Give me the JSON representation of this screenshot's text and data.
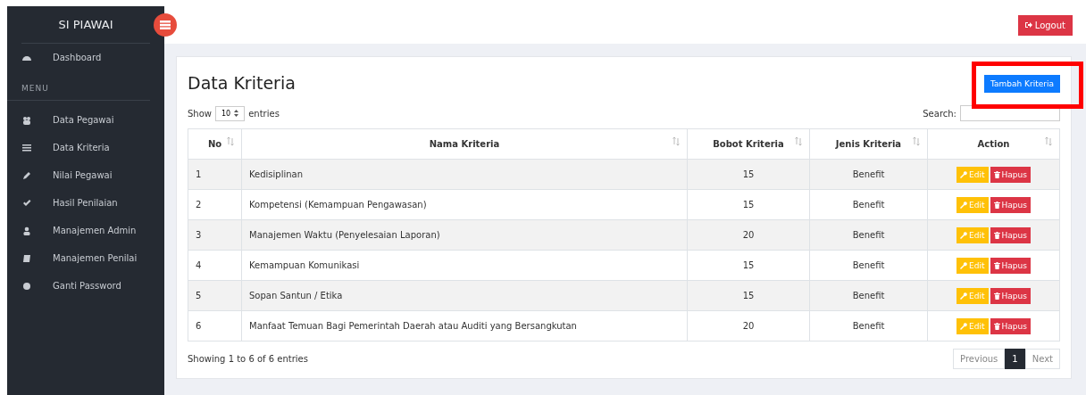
{
  "sidebar": {
    "brand": "SI PIAWAI",
    "top_items": [
      {
        "label": "Dashboard",
        "selected": false
      }
    ],
    "section_label": "MENU",
    "items": [
      {
        "label": "Data Pegawai",
        "selected": false
      },
      {
        "label": "Data Kriteria",
        "selected": false
      },
      {
        "label": "Nilai Pegawai",
        "selected": false
      },
      {
        "label": "Hasil Penilaian",
        "selected": false
      },
      {
        "label": "Manajemen Admin",
        "selected": false
      },
      {
        "label": "Manajemen Penilai",
        "selected": false
      },
      {
        "label": "Ganti Password",
        "selected": false
      }
    ]
  },
  "topbar": {
    "logout_button": "Logout"
  },
  "page": {
    "title": "Data Kriteria",
    "add_button": "Tambah Kriteria",
    "add_button_highlighted": true,
    "length": {
      "before": "Show",
      "value": "10",
      "after": "entries"
    },
    "search_label": "Search:",
    "table": {
      "columns": [
        "No",
        "Nama Kriteria",
        "Bobot Kriteria",
        "Jenis Kriteria",
        "Action"
      ],
      "rows": [
        {
          "no": "1",
          "nama": "Kedisiplinan",
          "bobot": "15",
          "jenis": "Benefit",
          "edit": "Edit",
          "hapus": "Hapus"
        },
        {
          "no": "2",
          "nama": "Kompetensi (Kemampuan Pengawasan)",
          "bobot": "15",
          "jenis": "Benefit",
          "edit": "Edit",
          "hapus": "Hapus"
        },
        {
          "no": "3",
          "nama": "Manajemen Waktu (Penyelesaian Laporan)",
          "bobot": "20",
          "jenis": "Benefit",
          "edit": "Edit",
          "hapus": "Hapus"
        },
        {
          "no": "4",
          "nama": "Kemampuan Komunikasi",
          "bobot": "15",
          "jenis": "Benefit",
          "edit": "Edit",
          "hapus": "Hapus"
        },
        {
          "no": "5",
          "nama": "Sopan Santun / Etika",
          "bobot": "15",
          "jenis": "Benefit",
          "edit": "Edit",
          "hapus": "Hapus"
        },
        {
          "no": "6",
          "nama": "Manfaat Temuan Bagi Pemerintah Daerah atau Auditi yang Bersangkutan",
          "bobot": "20",
          "jenis": "Benefit",
          "edit": "Edit",
          "hapus": "Hapus"
        }
      ]
    },
    "info": "Showing 1 to 6 of 6 entries",
    "pagination": [
      {
        "label": "Previous",
        "selected": false
      },
      {
        "label": "1",
        "selected": true
      },
      {
        "label": "Next",
        "selected": false
      }
    ]
  }
}
